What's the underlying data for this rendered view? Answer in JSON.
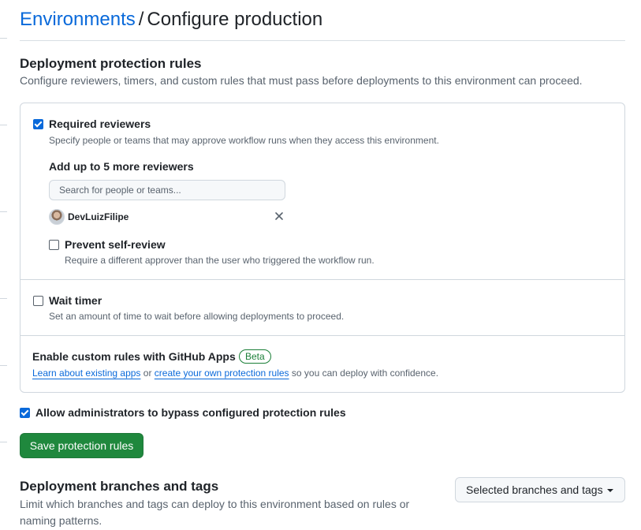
{
  "header": {
    "breadcrumb_link": "Environments",
    "separator": "/",
    "current": "Configure production"
  },
  "protection": {
    "heading": "Deployment protection rules",
    "description": "Configure reviewers, timers, and custom rules that must pass before deployments to this environment can proceed.",
    "required_reviewers": {
      "label": "Required reviewers",
      "checked": true,
      "note": "Specify people or teams that may approve workflow runs when they access this environment.",
      "add_label": "Add up to 5 more reviewers",
      "search_placeholder": "Search for people or teams...",
      "reviewers": [
        {
          "name": "DevLuizFilipe"
        }
      ],
      "prevent_self_review": {
        "label": "Prevent self-review",
        "checked": false,
        "note": "Require a different approver than the user who triggered the workflow run."
      }
    },
    "wait_timer": {
      "label": "Wait timer",
      "checked": false,
      "note": "Set an amount of time to wait before allowing deployments to proceed."
    },
    "custom_rules": {
      "label": "Enable custom rules with GitHub Apps",
      "badge": "Beta",
      "link1": "Learn about existing apps",
      "connector": "or",
      "link2": "create your own protection rules",
      "suffix": "so you can deploy with confidence."
    },
    "bypass": {
      "label": "Allow administrators to bypass configured protection rules",
      "checked": true
    },
    "save_label": "Save protection rules"
  },
  "branches": {
    "heading": "Deployment branches and tags",
    "description": "Limit which branches and tags can deploy to this environment based on rules or naming patterns.",
    "dropdown_value": "Selected branches and tags"
  },
  "colors": {
    "link": "#0969da",
    "primary_button": "#1f883d",
    "beta_badge": "#1a7f37",
    "checkbox_checked": "#0969da"
  }
}
